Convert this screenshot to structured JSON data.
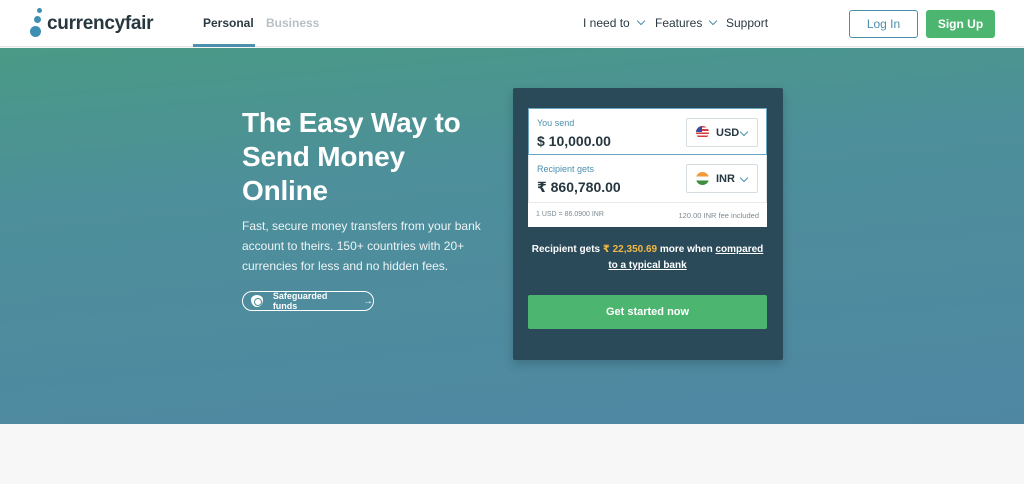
{
  "header": {
    "logo_text": "currencyfair",
    "tabs": [
      {
        "label": "Personal",
        "active": true
      },
      {
        "label": "Business",
        "active": false
      }
    ],
    "nav": [
      {
        "label": "I need to",
        "dropdown": true
      },
      {
        "label": "Features",
        "dropdown": true
      },
      {
        "label": "Support",
        "dropdown": false
      }
    ],
    "login_label": "Log In",
    "signup_label": "Sign Up"
  },
  "hero": {
    "title": "The Easy Way to Send Money Online",
    "subtitle": "Fast, secure money transfers from your bank account to theirs. 150+ countries with 20+ currencies for less and no hidden fees.",
    "safeguard_label": "Safeguarded funds",
    "safeguard_icon": "shield-icon"
  },
  "converter": {
    "send_label": "You send",
    "send_value": "$ 10,000.00",
    "send_currency": "USD",
    "recv_label": "Recipient gets",
    "recv_value": "₹ 860,780.00",
    "recv_currency": "INR",
    "rate_text": "1 USD = 86.0900 INR",
    "fee_amount": "120.00 INR",
    "fee_suffix": "fee included",
    "saving_prefix": "Recipient gets",
    "saving_amount": "₹ 22,350.69",
    "saving_middle": "more when",
    "saving_link": "compared to a typical bank",
    "cta_label": "Get started now"
  },
  "colors": {
    "accent_blue": "#4b90ad",
    "green": "#4cb570",
    "card_bg": "#2a4a59",
    "highlight": "#f2b845"
  }
}
